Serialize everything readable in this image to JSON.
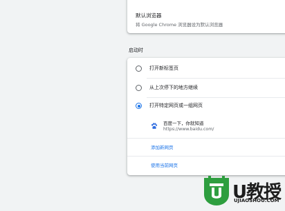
{
  "default_browser": {
    "title": "默认浏览器",
    "subtitle": "将 Google Chrome 浏览器设为默认浏览器"
  },
  "startup": {
    "section_title": "启动时",
    "options": [
      {
        "label": "打开新标签页",
        "checked": false
      },
      {
        "label": "从上次停下的地方继续",
        "checked": false
      },
      {
        "label": "打开特定网页或一组网页",
        "checked": true
      }
    ],
    "site": {
      "name": "百度一下，你就知道",
      "url": "https://www.baidu.com/",
      "icon": "baidu-paw-icon"
    },
    "add_page_link": "添加新网页",
    "use_current_link": "使用当前网页"
  },
  "watermark": {
    "brand": "U教授",
    "domain": "UJIAOSHOU.COM"
  },
  "colors": {
    "accent": "#1a73e8",
    "watermark_green": "#2e9e3f",
    "paw_blue": "#2f6ce0"
  }
}
